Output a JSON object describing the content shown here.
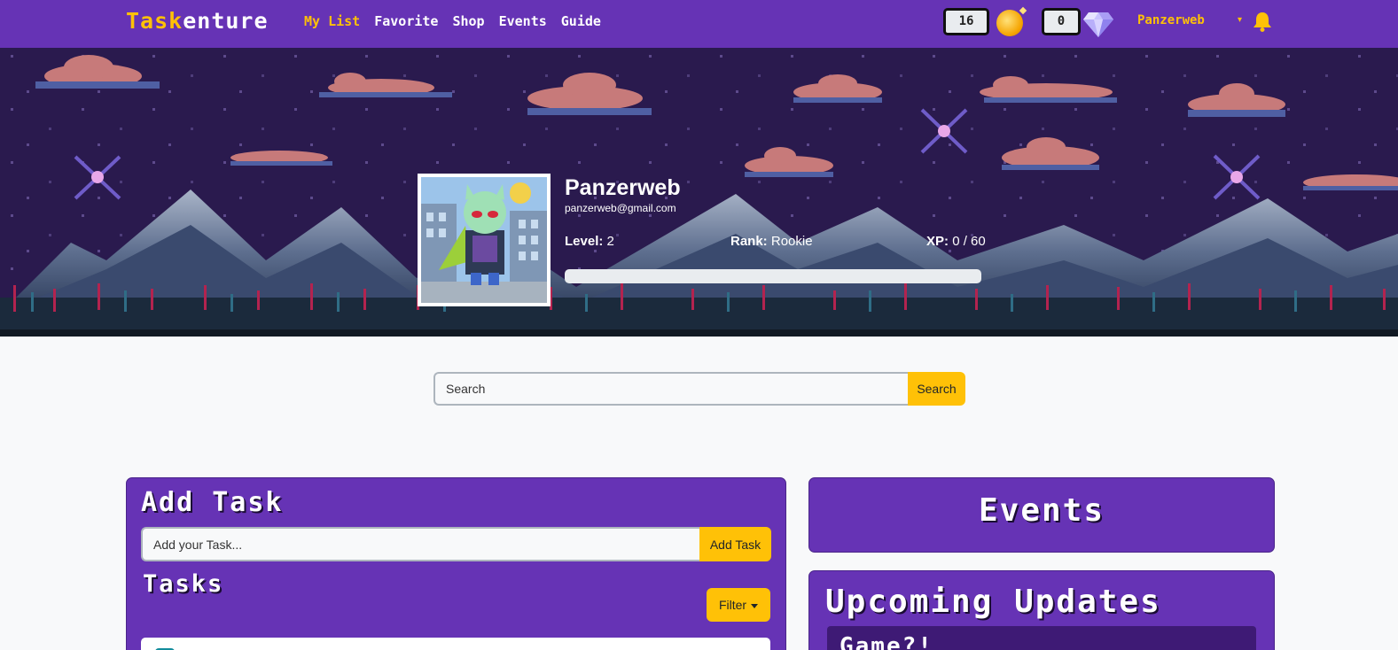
{
  "navbar": {
    "brand_part1": "Task",
    "brand_part2": "enture",
    "links": [
      "My List",
      "Favorite",
      "Shop",
      "Events",
      "Guide"
    ],
    "coins": "16",
    "gems": "0",
    "username": "Panzerweb"
  },
  "profile": {
    "name": "Panzerweb",
    "email": "panzerweb@gmail.com",
    "level_label": "Level:",
    "level": "2",
    "rank_label": "Rank:",
    "rank": "Rookie",
    "xp_label": "XP:",
    "xp": "0 / 60",
    "xp_progress": 0
  },
  "search": {
    "placeholder": "Search",
    "button": "Search"
  },
  "tasks": {
    "add_title": "Add Task",
    "input_placeholder": "Add your Task...",
    "add_button": "Add Task",
    "list_title": "Tasks",
    "filter_button": "Filter"
  },
  "events": {
    "title": "Events"
  },
  "updates": {
    "title": "Upcoming Updates",
    "first_item": "Game?!"
  },
  "colors": {
    "navbar": "#6633b5",
    "accent": "#ffc107",
    "hero_sky": "#2a1a4e"
  },
  "icons": {
    "coin": "coin-icon",
    "gem": "diamond-icon",
    "bell": "bell-icon",
    "avatar": "avatar-image"
  }
}
